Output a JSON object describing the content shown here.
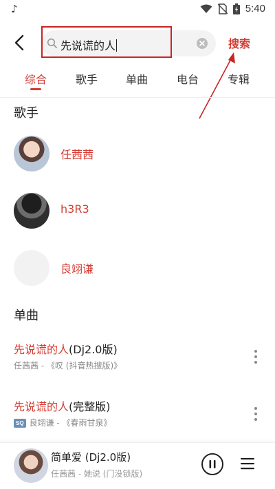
{
  "status_bar": {
    "time": "5:40",
    "music_note": "♪"
  },
  "search": {
    "query": "先说谎的人",
    "action_label": "搜索"
  },
  "tabs": [
    {
      "label": "综合"
    },
    {
      "label": "歌手"
    },
    {
      "label": "单曲"
    },
    {
      "label": "电台"
    },
    {
      "label": "专辑"
    }
  ],
  "sections": {
    "artists_title": "歌手",
    "songs_title": "单曲"
  },
  "artists": [
    {
      "name": "任茜茜"
    },
    {
      "name": "h3R3"
    },
    {
      "name": "良翊谦"
    }
  ],
  "songs": [
    {
      "title_highlight": "先说谎的人",
      "title_rest": "(Dj2.0版)",
      "subtitle": "任茜茜 - 《叹 (抖音热搜版)》",
      "badge": ""
    },
    {
      "title_highlight": "先说谎的人",
      "title_rest": "(完整版)",
      "subtitle": "良翊谦 - 《春雨甘泉》",
      "badge": "SQ"
    }
  ],
  "player": {
    "title": "简单爱 (Dj2.0版)",
    "subtitle": "任茜茜 - 她说 (门没锁版)"
  },
  "colors": {
    "accent": "#d43c33",
    "annotation_red": "#c82424"
  }
}
